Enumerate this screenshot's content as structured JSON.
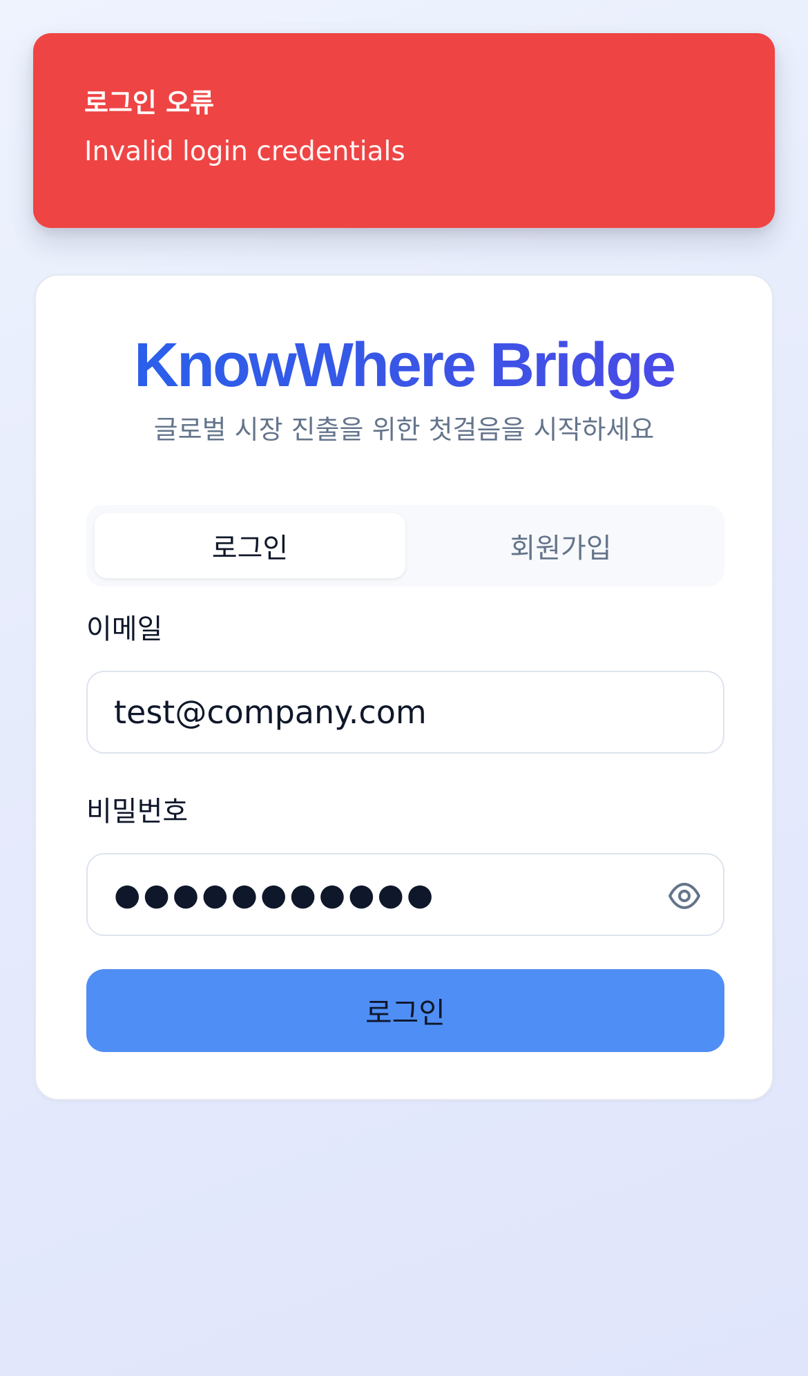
{
  "toast": {
    "title": "로그인 오류",
    "message": "Invalid login credentials"
  },
  "card": {
    "brand": "KnowWhere Bridge",
    "subtitle": "글로벌 시장 진출을 위한 첫걸음을 시작하세요"
  },
  "tabs": [
    {
      "label": "로그인",
      "active": true
    },
    {
      "label": "회원가입",
      "active": false
    }
  ],
  "form": {
    "email_label": "이메일",
    "email_value": "test@company.com",
    "password_label": "비밀번호",
    "password_value": "●●●●●●●●●●●",
    "password_toggle_icon": "eye-icon",
    "submit_label": "로그인"
  },
  "colors": {
    "error": "#ef4444",
    "brand_start": "#2563eb",
    "brand_end": "#4f46e5",
    "primary_button": "#4f8ef5"
  }
}
